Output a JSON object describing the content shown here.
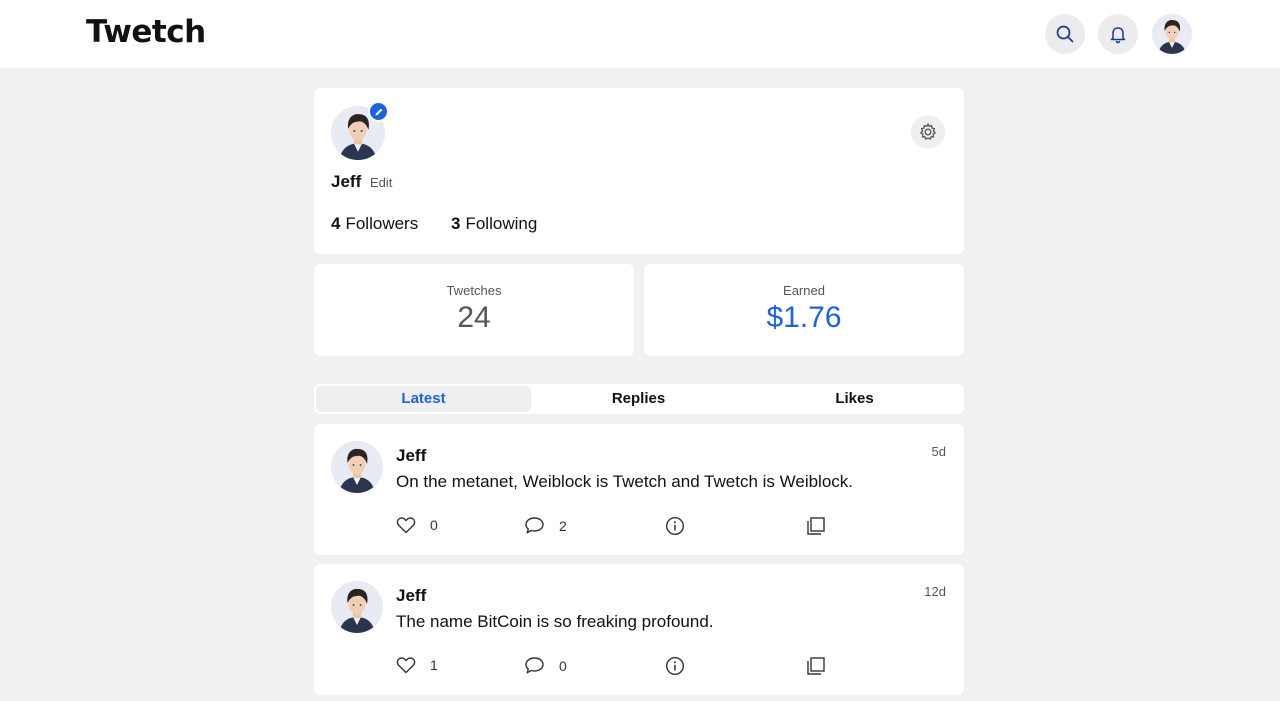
{
  "app": {
    "logo": "Twetch"
  },
  "header": {
    "search_icon": "search-icon",
    "bell_icon": "bell-icon"
  },
  "profile": {
    "name": "Jeff",
    "edit_label": "Edit",
    "followers_count": "4",
    "followers_label": "Followers",
    "following_count": "3",
    "following_label": "Following"
  },
  "stats": {
    "twetches_label": "Twetches",
    "twetches_value": "24",
    "earned_label": "Earned",
    "earned_value": "$1.76"
  },
  "tabs": [
    {
      "label": "Latest",
      "active": true
    },
    {
      "label": "Replies",
      "active": false
    },
    {
      "label": "Likes",
      "active": false
    }
  ],
  "posts": [
    {
      "author": "Jeff",
      "time": "5d",
      "text": "On the metanet, Weiblock is Twetch and Twetch is Weiblock.",
      "likes": "0",
      "replies": "2"
    },
    {
      "author": "Jeff",
      "time": "12d",
      "text": "The name BitCoin is so freaking profound.",
      "likes": "1",
      "replies": "0"
    }
  ],
  "colors": {
    "accent": "#1e62d8",
    "background": "#f1f1f3"
  }
}
